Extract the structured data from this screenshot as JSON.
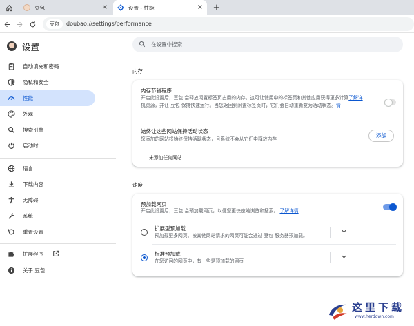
{
  "browser": {
    "tabs": [
      {
        "label": "豆包",
        "icon": "doubao-favicon"
      },
      {
        "label": "设置 - 性能",
        "icon": "gear-icon",
        "active": true
      }
    ],
    "new_tab": "+",
    "site_chip": "豆包",
    "url": "doubao://settings/performance"
  },
  "sidebar": {
    "title": "设置",
    "items": [
      {
        "label": "自动填充和密码",
        "icon": "clipboard-icon"
      },
      {
        "label": "隐私和安全",
        "icon": "shield-icon"
      },
      {
        "label": "性能",
        "icon": "speedometer-icon",
        "active": true
      },
      {
        "label": "外观",
        "icon": "palette-icon"
      },
      {
        "label": "搜索引擎",
        "icon": "search-icon"
      },
      {
        "label": "启动时",
        "icon": "power-icon"
      },
      {
        "label": "语言",
        "icon": "globe-icon"
      },
      {
        "label": "下载内容",
        "icon": "download-icon"
      },
      {
        "label": "无障碍",
        "icon": "accessibility-icon"
      },
      {
        "label": "系统",
        "icon": "wrench-icon"
      },
      {
        "label": "重置设置",
        "icon": "reset-icon"
      },
      {
        "label": "扩展程序",
        "icon": "puzzle-icon"
      },
      {
        "label": "关于 豆包",
        "icon": "info-icon"
      }
    ]
  },
  "search": {
    "placeholder": "在设置中搜索"
  },
  "memory": {
    "title": "内存",
    "saver_title": "内存节省程序",
    "saver_desc_1": "开启此设置后，豆包 会释放闲置标签页占用的内存。这可让使用中的标签页和其他应用获得更多计算",
    "saver_desc_2": "机资源，并让 豆包 保持快速运行。当您返回到闲置标签页时，它们会自动重新变为活动状态。",
    "saver_link_1": "了解详",
    "saver_link_2": "情",
    "saver_enabled": false,
    "always_active_title": "始终让这些网站保持活动状态",
    "always_active_desc": "您添加的网站将始终保持活跃状态，且系统不会从它们中释放内存",
    "add_button": "添加",
    "no_sites": "未添加任何网站"
  },
  "speed": {
    "title": "速度",
    "preload_title": "预加载网页",
    "preload_desc": "开启此设置后，豆包 会预加载网页，以便您更快速地浏览和搜索。",
    "preload_link": "了解详情",
    "preload_enabled": true,
    "options": [
      {
        "title": "扩展型预加载",
        "desc": "预加载更多网页。被其他网站请求的网页可能会通过 豆包 服务器预加载。",
        "selected": false
      },
      {
        "title": "标准预加载",
        "desc": "在您访问的网页中，有一些是预加载的网页",
        "selected": true
      }
    ]
  },
  "watermark": {
    "text": "这里下载",
    "url": "www.herdown.com"
  },
  "colors": {
    "accent": "#0b57d0",
    "active_nav_bg": "#d3e3fd",
    "tabstrip_bg": "#dee1e6"
  }
}
